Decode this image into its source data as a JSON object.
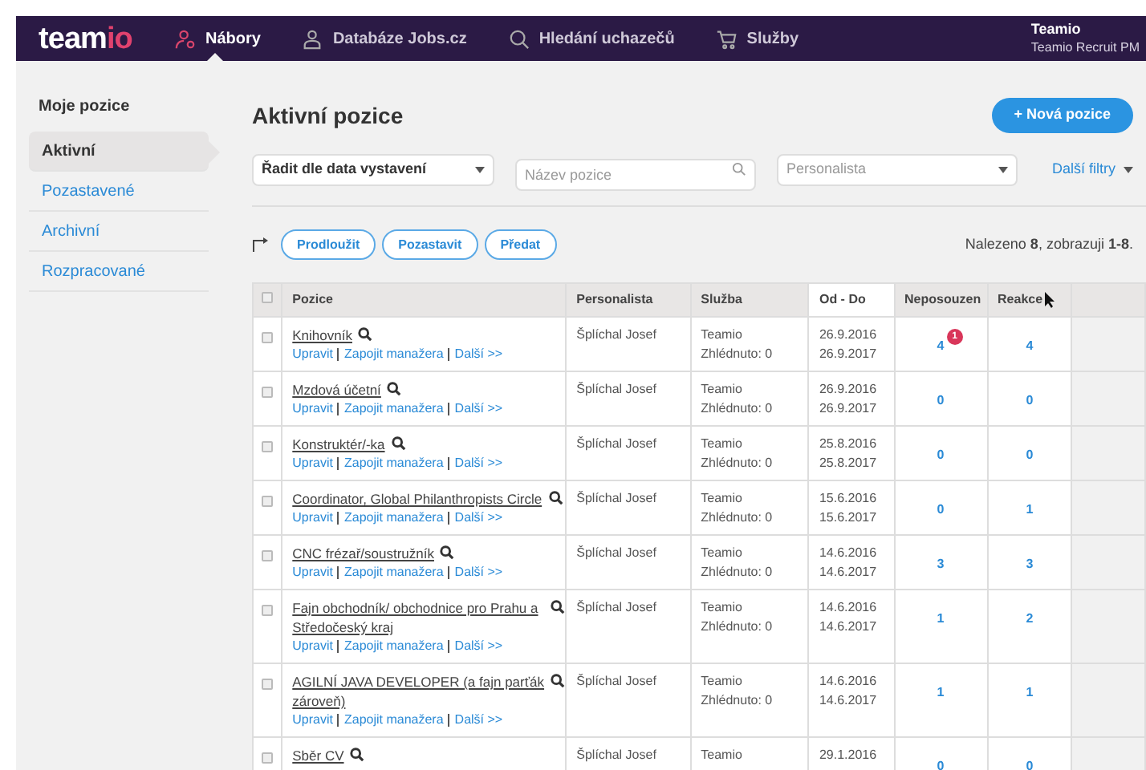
{
  "nav": {
    "logo_main": "team",
    "logo_accent": "io",
    "items": [
      {
        "label": "Nábory",
        "selected": true
      },
      {
        "label": "Databáze Jobs.cz",
        "selected": false
      },
      {
        "label": "Hledání uchazečů",
        "selected": false
      },
      {
        "label": "Služby",
        "selected": false
      }
    ],
    "user": {
      "name": "Teamio",
      "role": "Teamio Recruit PM"
    }
  },
  "sidebar": {
    "heading": "Moje pozice",
    "items": [
      {
        "label": "Aktivní",
        "selected": true
      },
      {
        "label": "Pozastavené",
        "selected": false
      },
      {
        "label": "Archivní",
        "selected": false
      },
      {
        "label": "Rozpracované",
        "selected": false
      }
    ]
  },
  "page_title": "Aktivní pozice",
  "new_button": "+ Nová pozice",
  "filters": {
    "sort": "Řadit dle data vystavení",
    "name_placeholder": "Název pozice",
    "recruiter_placeholder": "Personalista",
    "more": "Další filtry"
  },
  "actions": [
    "Prodloužit",
    "Pozastavit",
    "Předat"
  ],
  "found": "Nalezeno **8**, zobrazuji **1-8**.",
  "table": {
    "columns": [
      "Pozice",
      "Personalista",
      "Služba",
      "Od - Do",
      "Neposouzen",
      "Reakce"
    ],
    "header_checked": false,
    "rows": [
      {
        "checked": false,
        "title": "Knihovník",
        "links": [
          "Upravit",
          "Zapojit manažera",
          "Další >>"
        ],
        "recruiter": "Šplíchal Josef",
        "service": "Teamio",
        "views": "Zhlédnuto: 0",
        "from": "26.9.2016",
        "to": "26.9.2017",
        "unreviewed": "4",
        "badge": "1",
        "reactions": "4"
      },
      {
        "checked": false,
        "title": "Mzdová účetní",
        "links": [
          "Upravit",
          "Zapojit manažera",
          "Další >>"
        ],
        "recruiter": "Šplíchal Josef",
        "service": "Teamio",
        "views": "Zhlédnuto: 0",
        "from": "26.9.2016",
        "to": "26.9.2017",
        "unreviewed": "0",
        "reactions": "0"
      },
      {
        "checked": false,
        "title": "Konstruktér/-ka",
        "links": [
          "Upravit",
          "Zapojit manažera",
          "Další >>"
        ],
        "recruiter": "Šplíchal Josef",
        "service": "Teamio",
        "views": "Zhlédnuto: 0",
        "from": "25.8.2016",
        "to": "25.8.2017",
        "unreviewed": "0",
        "reactions": "0"
      },
      {
        "checked": false,
        "title": "Coordinator, Global Philanthropists Circle",
        "links": [
          "Upravit",
          "Zapojit manažera",
          "Další >>"
        ],
        "recruiter": "Šplíchal Josef",
        "service": "Teamio",
        "views": "Zhlédnuto: 0",
        "from": "15.6.2016",
        "to": "15.6.2017",
        "unreviewed": "0",
        "reactions": "1"
      },
      {
        "checked": false,
        "title": "CNC frézař/soustružník",
        "links": [
          "Upravit",
          "Zapojit manažera",
          "Další >>"
        ],
        "recruiter": "Šplíchal Josef",
        "service": "Teamio",
        "views": "Zhlédnuto: 0",
        "from": "14.6.2016",
        "to": "14.6.2017",
        "unreviewed": "3",
        "reactions": "3"
      },
      {
        "checked": false,
        "title": "Fajn obchodník/ obchodnice pro Prahu a Středočeský kraj",
        "links": [
          "Upravit",
          "Zapojit manažera",
          "Další >>"
        ],
        "recruiter": "Šplíchal Josef",
        "service": "Teamio",
        "views": "Zhlédnuto: 0",
        "from": "14.6.2016",
        "to": "14.6.2017",
        "unreviewed": "1",
        "reactions": "2"
      },
      {
        "checked": false,
        "title": "AGILNÍ JAVA DEVELOPER (a fajn parťák zároveň)",
        "links": [
          "Upravit",
          "Zapojit manažera",
          "Další >>"
        ],
        "recruiter": "Šplíchal Josef",
        "service": "Teamio",
        "views": "Zhlédnuto: 0",
        "from": "14.6.2016",
        "to": "14.6.2017",
        "unreviewed": "1",
        "reactions": "1"
      },
      {
        "checked": false,
        "title": "Sběr CV",
        "recruiter": "Šplíchal Josef",
        "service": "Teamio",
        "from": "29.1.2016",
        "unreviewed": "0",
        "reactions": "0"
      }
    ]
  }
}
